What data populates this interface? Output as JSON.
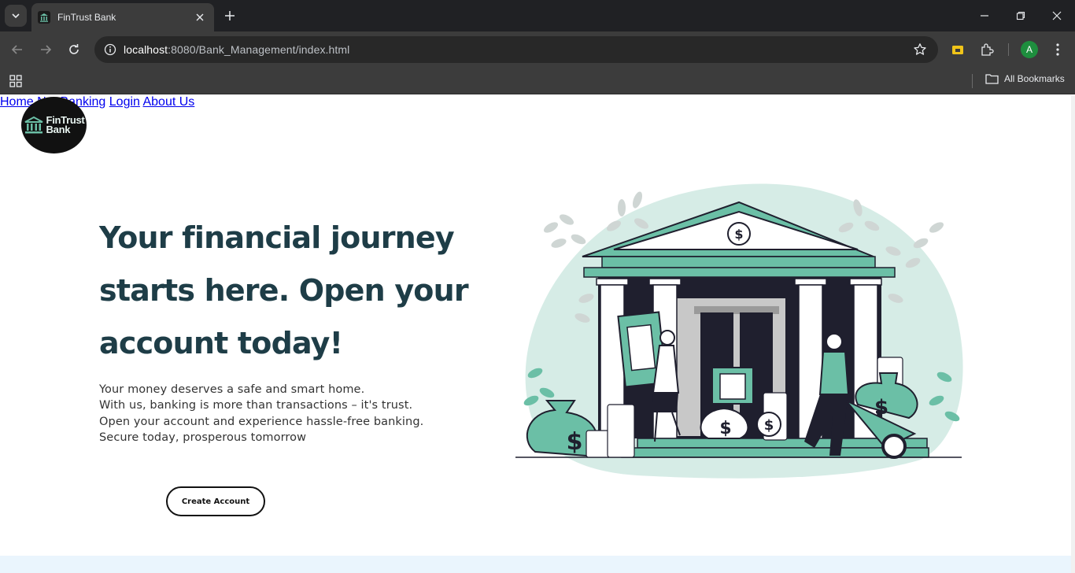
{
  "browser": {
    "tab_title": "FinTrust Bank",
    "url_host": "localhost",
    "url_path": ":8080/Bank_Management/index.html",
    "profile_initial": "A",
    "bookmarks_label": "All Bookmarks"
  },
  "site": {
    "logo_line1": "FinTrust",
    "logo_line2": "Bank",
    "nav": [
      "Home",
      "Net Banking",
      "Login",
      "About Us"
    ],
    "hero": {
      "title_lines": [
        "Your financial journey",
        "starts here. Open your",
        "account today!"
      ],
      "text_lines": [
        "Your money deserves a safe and smart home.",
        "With us, banking is more than transactions – it's trust.",
        "Open your account and experience hassle-free banking.",
        "Secure today, prosperous tomorrow"
      ],
      "cta_label": "Create Account",
      "illustration": "bank-building-illustration"
    },
    "colors": {
      "heading": "#1e3d47",
      "accent": "#6bbfa6",
      "accent_light": "#d6ece6",
      "dark": "#1f1f2e",
      "band": "#eaf5fd"
    }
  }
}
